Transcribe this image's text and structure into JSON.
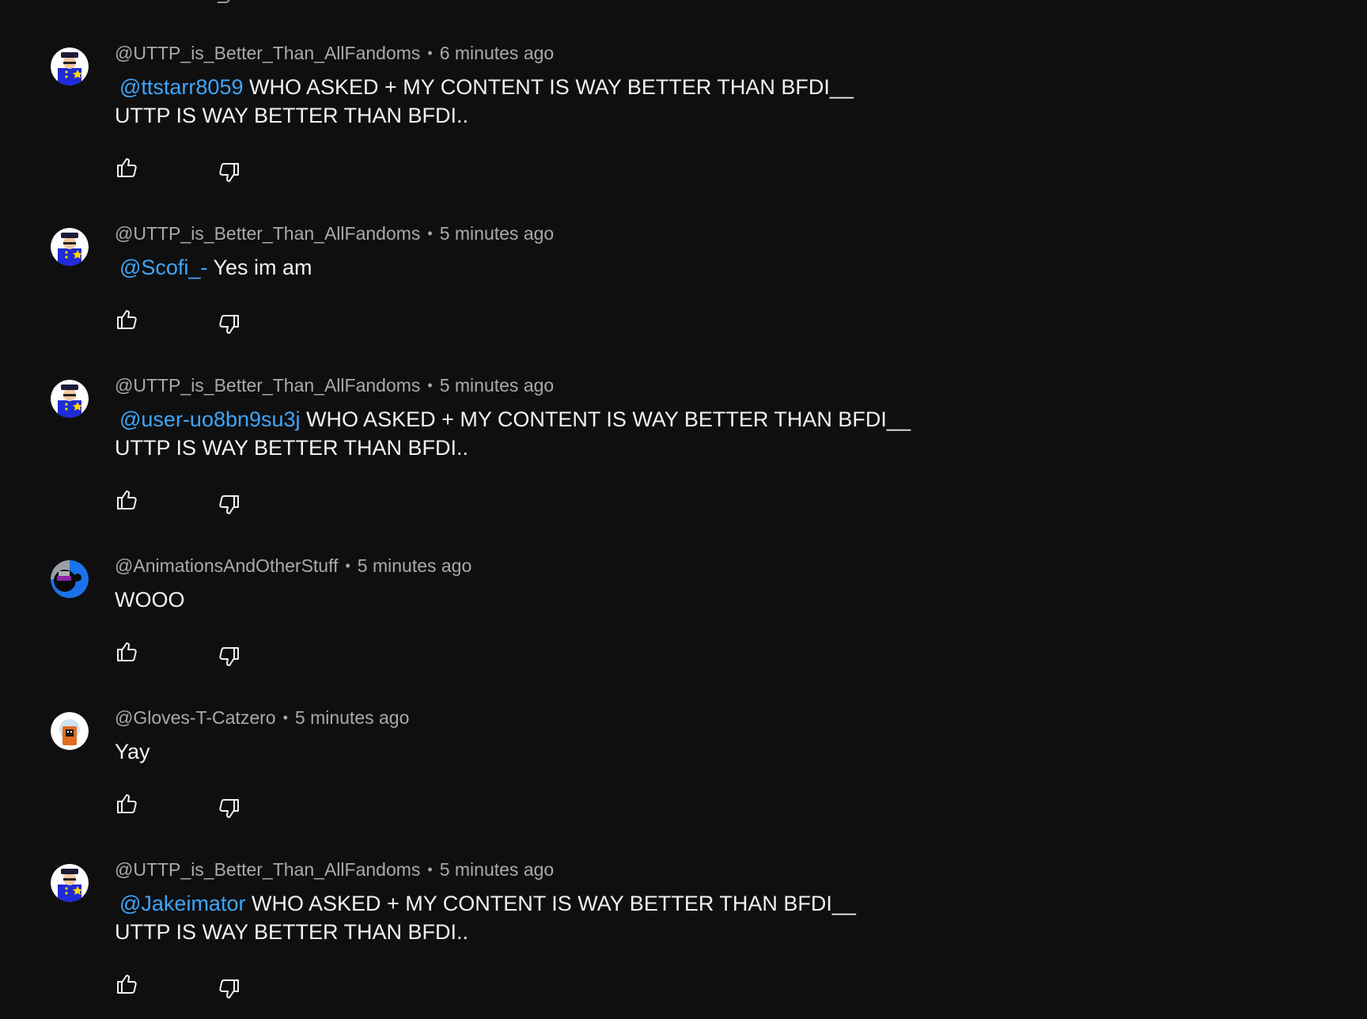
{
  "colors": {
    "background": "#0f0f0f",
    "text": "#f1f1f1",
    "meta": "#aaaaaa",
    "mention": "#3ea6ff"
  },
  "icons": {
    "like": "thumbs-up-icon",
    "dislike": "thumbs-down-icon"
  },
  "comments": [
    {
      "author": "@UTTP_is_Better_Than_AllFandoms",
      "time": "6 minutes ago",
      "mention": "@ttstarr8059",
      "text_line1": " WHO ASKED + MY CONTENT IS WAY BETTER THAN BFDI__",
      "text_line2": "UTTP IS WAY BETTER THAN BFDI.."
    },
    {
      "author": "@UTTP_is_Better_Than_AllFandoms",
      "time": "5 minutes ago",
      "mention": "@Scofi_-",
      "text_line1": " Yes im am"
    },
    {
      "author": "@UTTP_is_Better_Than_AllFandoms",
      "time": "5 minutes ago",
      "mention": "@user-uo8bn9su3j",
      "text_line1": " WHO ASKED + MY CONTENT IS WAY BETTER THAN BFDI__",
      "text_line2": "UTTP IS WAY BETTER THAN BFDI.."
    },
    {
      "author": "@AnimationsAndOtherStuff",
      "time": "5 minutes ago",
      "text_line1": "WOOO"
    },
    {
      "author": "@Gloves-T-Catzero",
      "time": "5 minutes ago",
      "text_line1": "Yay"
    },
    {
      "author": "@UTTP_is_Better_Than_AllFandoms",
      "time": "5 minutes ago",
      "mention": "@Jakeimator",
      "text_line1": " WHO ASKED + MY CONTENT IS WAY BETTER THAN BFDI__",
      "text_line2": "UTTP IS WAY BETTER THAN BFDI.."
    }
  ]
}
